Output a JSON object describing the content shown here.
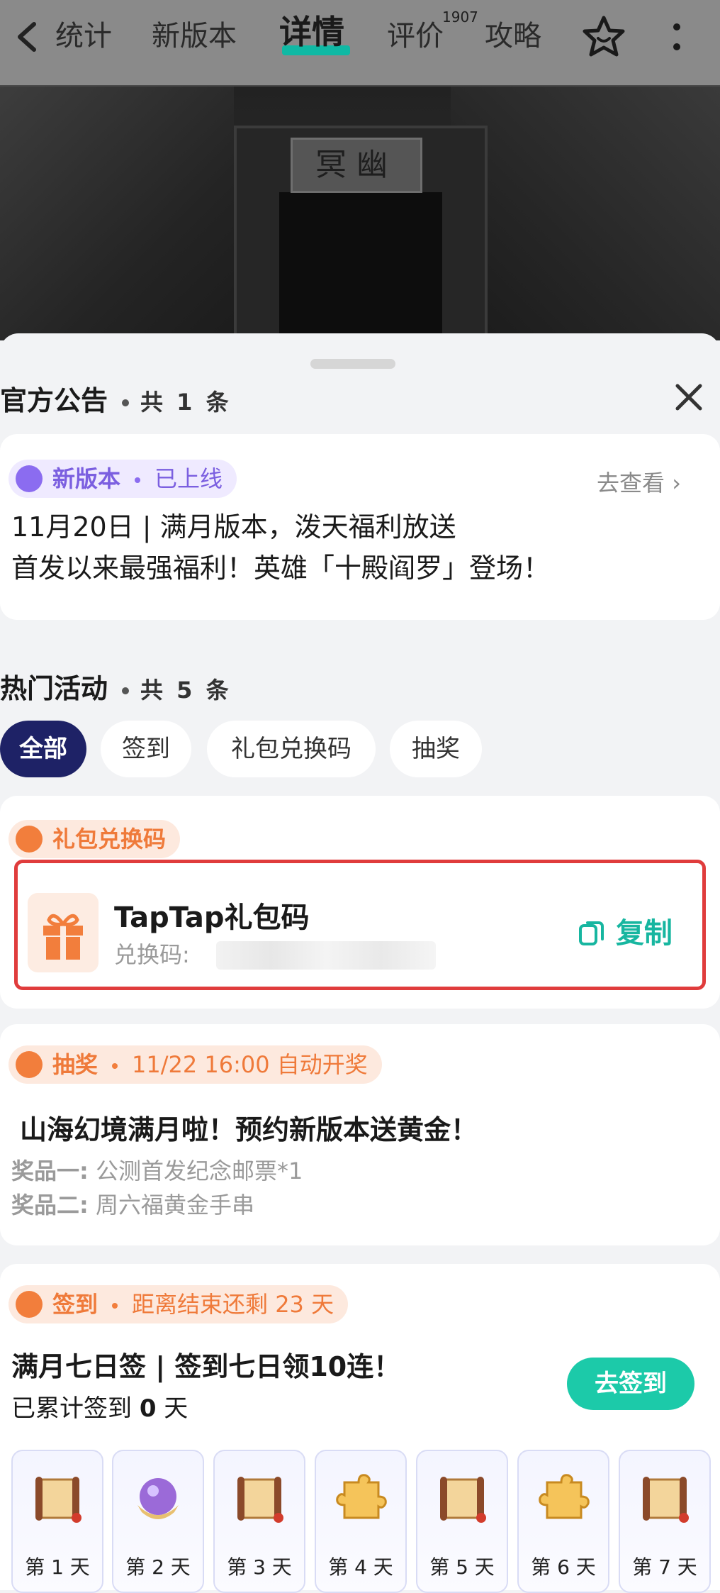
{
  "nav": {
    "tabs": [
      "统计",
      "新版本",
      "详情",
      "评价",
      "攻略"
    ],
    "review_count": "1907"
  },
  "banner": {
    "plaque_text": "冥幽"
  },
  "announcement": {
    "title": "官方公告",
    "count": "共 1 条",
    "tag_label": "新版本",
    "tag_status": "已上线",
    "link": "去查看",
    "line1": "11月20日 | 满月版本，泼天福利放送",
    "line2": "首发以来最强福利！英雄「十殿阎罗」登场！"
  },
  "activities": {
    "title": "热门活动",
    "count": "共 5 条",
    "filters": [
      "全部",
      "签到",
      "礼包兑换码",
      "抽奖"
    ]
  },
  "gift_code": {
    "tag": "礼包兑换码",
    "title": "TapTap礼包码",
    "sub": "兑换码:",
    "copy": "复制"
  },
  "lottery": {
    "tag": "抽奖",
    "time": "11/22 16:00 自动开奖",
    "title": "山海幻境满月啦！预约新版本送黄金！",
    "prize1_label": "奖品一:",
    "prize1": "公测首发纪念邮票*1",
    "prize2_label": "奖品二:",
    "prize2": "周六福黄金手串"
  },
  "checkin": {
    "tag": "签到",
    "remain": "距离结束还剩 23 天",
    "title": "满月七日签 | 签到七日领10连！",
    "progress_prefix": "已累计签到",
    "progress_value": "0",
    "progress_suffix": "天",
    "button": "去签到",
    "days": [
      "第 1 天",
      "第 2 天",
      "第 3 天",
      "第 4 天",
      "第 5 天",
      "第 6 天",
      "第 7 天"
    ]
  }
}
